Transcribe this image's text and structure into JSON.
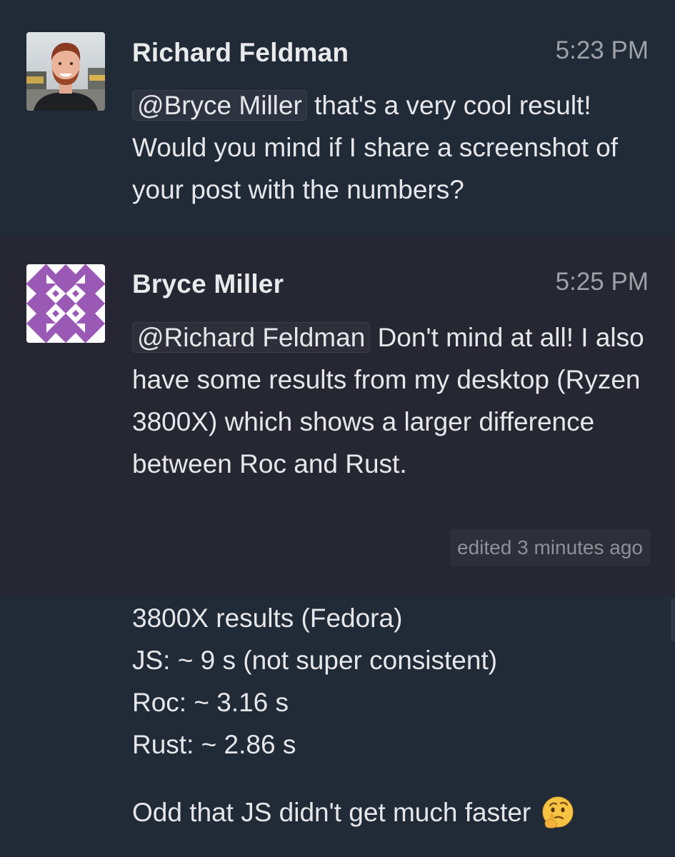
{
  "messages": [
    {
      "sender": "Richard Feldman",
      "time": "5:23 PM",
      "mention": "@Bryce Miller",
      "text_after_mention": "that's a very cool result! Would you mind if I share a screenshot of your post with the numbers?",
      "avatar_icon": "profile-photo"
    },
    {
      "sender": "Bryce Miller",
      "time": "5:25 PM",
      "mention": "@Richard Feldman",
      "text_after_mention": "Don't mind at all! I also have some results from my desktop (Ryzen 3800X) which shows a larger difference between Roc and Rust.",
      "edited": "edited 3 minutes ago",
      "avatar_icon": "identicon-avatar"
    }
  ],
  "continuation": {
    "lines": [
      "3800X results (Fedora)",
      "JS: ~ 9 s (not super consistent)",
      "Roc: ~ 3.16 s",
      "Rust: ~ 2.86 s"
    ],
    "final_line": "Odd that JS didn't get much faster",
    "final_emoji": "thinking-face-icon"
  },
  "colors": {
    "background": "#212a37",
    "highlight_background": "#272733",
    "identicon_purple": "#9b59b6"
  }
}
